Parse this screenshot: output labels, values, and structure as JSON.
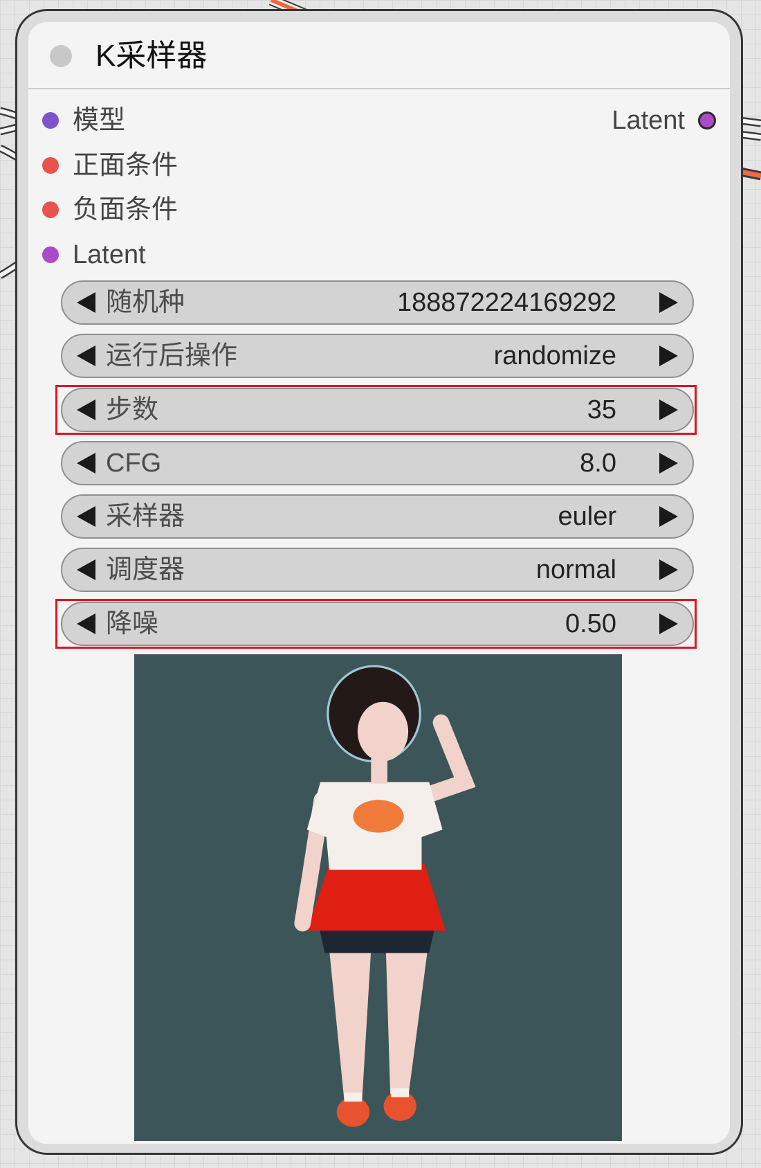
{
  "node": {
    "title": "K采样器",
    "title_dot_color": "#c8c8c8"
  },
  "inputs": [
    {
      "label": "模型",
      "color": "#7f52cc"
    },
    {
      "label": "正面条件",
      "color": "#e9524f"
    },
    {
      "label": "负面条件",
      "color": "#e9524f"
    },
    {
      "label": "Latent",
      "color": "#aa4bc7"
    }
  ],
  "outputs": [
    {
      "label": "Latent",
      "color": "#aa4bc7"
    }
  ],
  "widgets": [
    {
      "label": "随机种",
      "value": "188872224169292",
      "highlighted": false
    },
    {
      "label": "运行后操作",
      "value": "randomize",
      "highlighted": false
    },
    {
      "label": "步数",
      "value": "35",
      "highlighted": true
    },
    {
      "label": "CFG",
      "value": "8.0",
      "highlighted": false
    },
    {
      "label": "采样器",
      "value": "euler",
      "highlighted": false
    },
    {
      "label": "调度器",
      "value": "normal",
      "highlighted": false
    },
    {
      "label": "降噪",
      "value": "0.50",
      "highlighted": true
    }
  ],
  "colors": {
    "highlight": "#e0141e",
    "wire_orange": "#ee6a3e",
    "preview_background": "#3c5559",
    "node_body": "#f4f4f4"
  },
  "icons": {
    "status": "circle-icon",
    "decrement": "left-triangle-icon",
    "increment": "right-triangle-icon"
  }
}
